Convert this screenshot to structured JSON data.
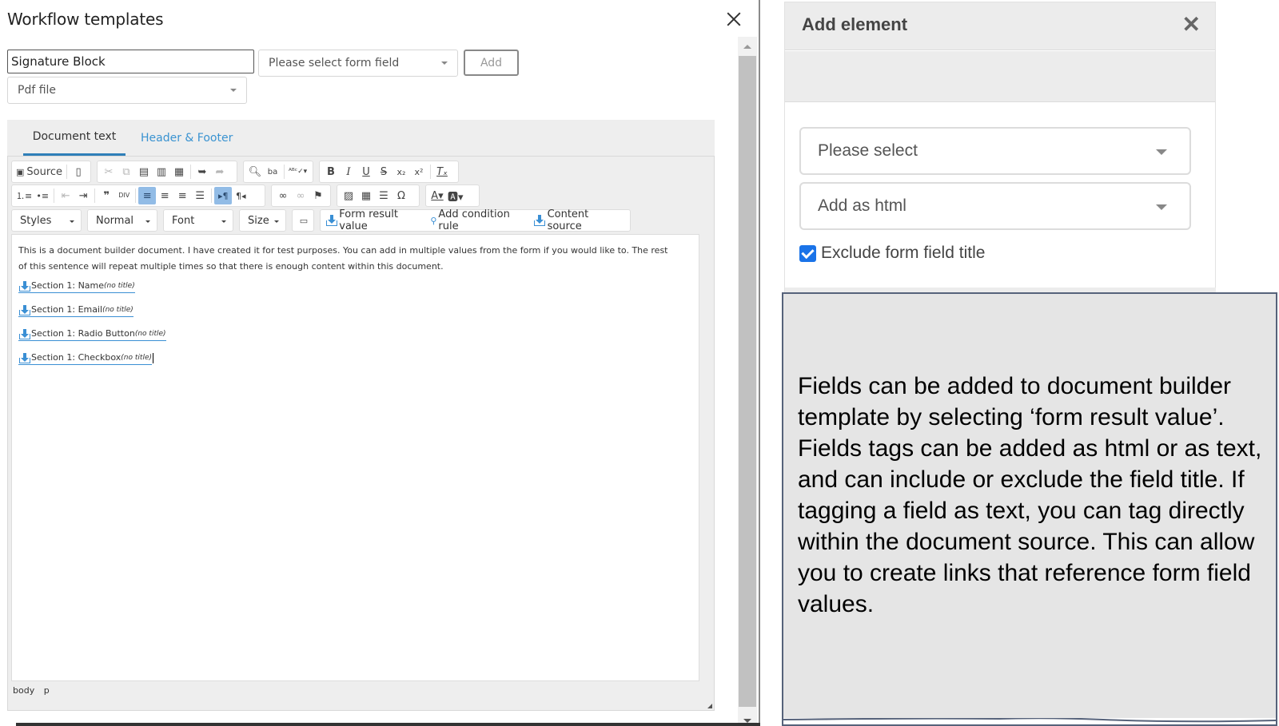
{
  "modal": {
    "title": "Workflow templates",
    "close_icon": "close-icon"
  },
  "form": {
    "name_value": "Signature Block",
    "form_field_select": "Please select form field",
    "add_label": "Add",
    "file_type_select": "Pdf file"
  },
  "tabs": [
    {
      "label": "Document text",
      "active": true
    },
    {
      "label": "Header & Footer",
      "active": false
    }
  ],
  "toolbar": {
    "row1": {
      "source_label": "Source",
      "icons": [
        "source-icon",
        "new-page-icon",
        "cut-icon",
        "copy-icon",
        "paste-icon",
        "paste-text-icon",
        "paste-word-icon",
        "undo-icon",
        "redo-icon",
        "find-icon",
        "replace-icon",
        "spellcheck-icon",
        "bold-icon",
        "italic-icon",
        "underline-icon",
        "strikethrough-icon",
        "subscript-icon",
        "superscript-icon",
        "remove-format-icon"
      ]
    },
    "row2": {
      "icons": [
        "numbered-list-icon",
        "bulleted-list-icon",
        "outdent-icon",
        "indent-icon",
        "blockquote-icon",
        "div-icon",
        "align-left-icon",
        "align-center-icon",
        "align-right-icon",
        "justify-icon",
        "ltr-icon",
        "rtl-icon",
        "link-icon",
        "unlink-icon",
        "anchor-icon",
        "image-icon",
        "table-icon",
        "horizontal-rule-icon",
        "special-char-icon",
        "text-color-icon",
        "bg-color-icon"
      ]
    },
    "row3": {
      "styles": "Styles",
      "format": "Normal",
      "font": "Font",
      "size": "Size",
      "form_result_value": "Form result value",
      "add_condition_rule": "Add condition rule",
      "content_source": "Content source"
    }
  },
  "document": {
    "paragraph": "This is a document builder document. I have created it for test purposes. You can add in multiple values from the form if you would like to. The rest of this sentence will repeat multiple times so that there is enough content within this document.",
    "fields": [
      {
        "label": "Section 1: Name",
        "suffix": "(no title)"
      },
      {
        "label": "Section 1: Email",
        "suffix": "(no title)"
      },
      {
        "label": "Section 1: Radio Button",
        "suffix": "(no title)"
      },
      {
        "label": "Section 1: Checkbox",
        "suffix": "(no title)"
      }
    ]
  },
  "status_bar": {
    "path": [
      "body",
      "p"
    ]
  },
  "add_element": {
    "title": "Add element",
    "select_1": "Please select",
    "select_2": "Add as html",
    "checkbox_label": "Exclude form field title",
    "checkbox_checked": true
  },
  "callout": {
    "text": "Fields can be added to document builder template by selecting ‘form result value’. Fields tags can be added as html or as text, and can include or exclude the field title. If tagging a field as text, you can tag directly within the document source. This can allow you to create links that reference form field values."
  },
  "colors": {
    "accent": "#3a93d1",
    "active_toolbar": "#92bce6",
    "checkbox": "#1a73e8",
    "callout_bg": "#e5e5e5"
  }
}
